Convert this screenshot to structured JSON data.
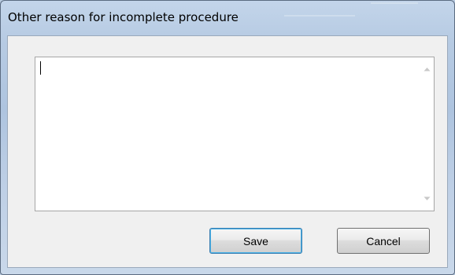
{
  "window": {
    "title": "Other reason for incomplete procedure"
  },
  "reason_field": {
    "value": "",
    "placeholder": ""
  },
  "buttons": {
    "save_label": "Save",
    "cancel_label": "Cancel"
  },
  "scrollbar": {
    "up_icon": "scroll-up-arrow-icon",
    "down_icon": "scroll-down-arrow-icon"
  },
  "colors": {
    "title_bar": "#b7cbe3",
    "client_background": "#f0f0f0",
    "default_button_border": "#3c7fb1"
  }
}
